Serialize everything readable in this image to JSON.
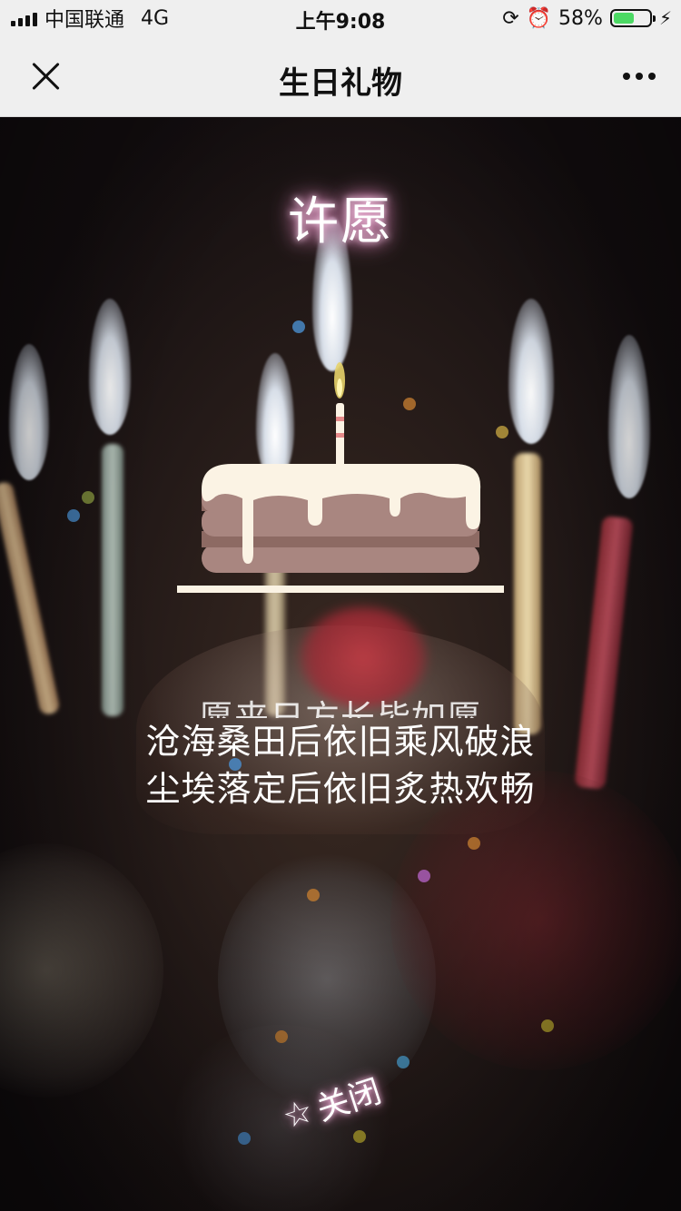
{
  "status_bar": {
    "carrier": "中国联通",
    "network": "4G",
    "time": "上午9:08",
    "battery_percent": "58%",
    "battery_level": 0.58
  },
  "nav": {
    "title": "生日礼物",
    "close_icon": "close-icon",
    "more_icon": "more-icon"
  },
  "wish": {
    "title": "许愿",
    "lines": [
      "愿来日方长皆如愿",
      "沧海桑田后依旧乘风破浪",
      "尘埃落定后依旧炙热欢畅"
    ],
    "close_label": "关闭",
    "close_icon": "star-icon"
  },
  "colors": {
    "glow": "#ff9ad5",
    "cake_body": "#a98680",
    "cake_stripe": "#8d6a63",
    "icing": "#fbf3e4",
    "battery_fill": "#4cd964"
  }
}
